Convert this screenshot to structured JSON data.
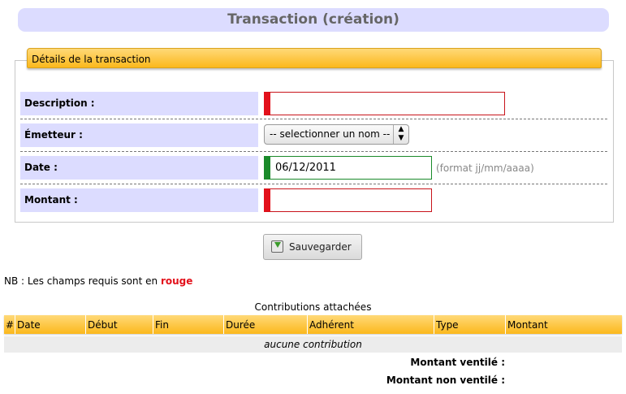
{
  "page_title": "Transaction (création)",
  "section": {
    "legend": "Détails de la transaction"
  },
  "form": {
    "description": {
      "label": "Description :",
      "value": ""
    },
    "emetteur": {
      "label": "Émetteur :",
      "selected": "-- selectionner un nom --"
    },
    "date": {
      "label": "Date :",
      "value": "06/12/2011",
      "hint": "(format jj/mm/aaaa)"
    },
    "montant": {
      "label": "Montant :",
      "value": ""
    }
  },
  "save_button": {
    "label": "Sauvegarder",
    "icon": "save-icon"
  },
  "note": {
    "prefix": "NB : Les champs requis sont en ",
    "highlight": "rouge"
  },
  "contributions": {
    "caption": "Contributions attachées",
    "columns": [
      "#",
      "Date",
      "Début",
      "Fin",
      "Durée",
      "Adhérent",
      "Type",
      "Montant"
    ],
    "empty_text": "aucune contribution"
  },
  "totals": {
    "ventile_label": "Montant ventilé :",
    "non_ventile_label": "Montant non ventilé :"
  },
  "colors": {
    "required": "#e3111b",
    "valid": "#1a8a2a",
    "label_bg": "#dcdcff",
    "header_bg": "#fbb81c"
  }
}
